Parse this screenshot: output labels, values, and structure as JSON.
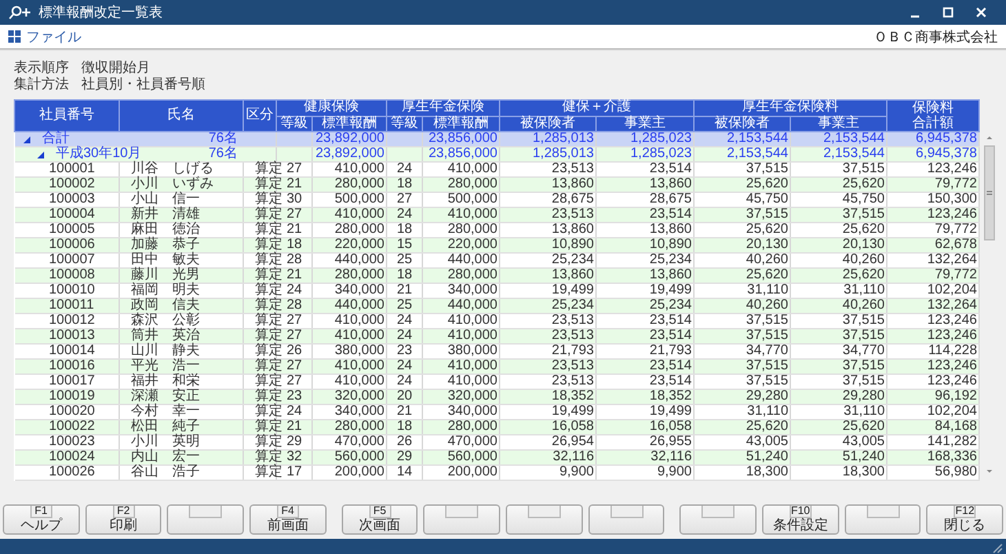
{
  "window": {
    "title": "標準報酬改定一覧表"
  },
  "menu": {
    "items": [
      {
        "label": "ファイル"
      }
    ],
    "company": "ＯＢＣ商事株式会社"
  },
  "conditions": [
    {
      "label": "表示順序",
      "value": "徴収開始月"
    },
    {
      "label": "集計方法",
      "value": "社員別・社員番号順"
    }
  ],
  "table": {
    "columns": [
      {
        "label": "社員番号"
      },
      {
        "label": "氏名"
      },
      {
        "label": "区分"
      },
      {
        "label": "健康保険",
        "children": [
          {
            "label": "等級"
          },
          {
            "label": "標準報酬"
          }
        ]
      },
      {
        "label": "厚生年金保険",
        "children": [
          {
            "label": "等級"
          },
          {
            "label": "標準報酬"
          }
        ]
      },
      {
        "label": "健保＋介護",
        "children": [
          {
            "label": "被保険者"
          },
          {
            "label": "事業主"
          }
        ]
      },
      {
        "label": "厚生年金保険料",
        "children": [
          {
            "label": "被保険者"
          },
          {
            "label": "事業主"
          }
        ]
      },
      {
        "label": "保険料合計額"
      }
    ],
    "rows": [
      {
        "kind": "total",
        "expanded": true,
        "label": "合計",
        "count": "76名",
        "amounts": [
          "23,892,000",
          "23,856,000",
          "1,285,013",
          "1,285,023",
          "2,153,544",
          "2,153,544",
          "6,945,378"
        ]
      },
      {
        "kind": "subtotal",
        "expanded": true,
        "label": "平成30年10月",
        "count": "76名",
        "amounts": [
          "23,892,000",
          "23,856,000",
          "1,285,013",
          "1,285,023",
          "2,153,544",
          "2,153,544",
          "6,945,378"
        ]
      },
      {
        "kind": "employee",
        "cells": [
          "100001",
          "川谷　しげる",
          "算定",
          "27",
          "410,000",
          "24",
          "410,000",
          "23,513",
          "23,514",
          "37,515",
          "37,515",
          "123,246"
        ]
      },
      {
        "kind": "employee",
        "cells": [
          "100002",
          "小川　いずみ",
          "算定",
          "21",
          "280,000",
          "18",
          "280,000",
          "13,860",
          "13,860",
          "25,620",
          "25,620",
          "79,772"
        ]
      },
      {
        "kind": "employee",
        "cells": [
          "100003",
          "小山　信一",
          "算定",
          "30",
          "500,000",
          "27",
          "500,000",
          "28,675",
          "28,675",
          "45,750",
          "45,750",
          "150,300"
        ]
      },
      {
        "kind": "employee",
        "cells": [
          "100004",
          "新井　清雄",
          "算定",
          "27",
          "410,000",
          "24",
          "410,000",
          "23,513",
          "23,514",
          "37,515",
          "37,515",
          "123,246"
        ]
      },
      {
        "kind": "employee",
        "cells": [
          "100005",
          "麻田　徳治",
          "算定",
          "21",
          "280,000",
          "18",
          "280,000",
          "13,860",
          "13,860",
          "25,620",
          "25,620",
          "79,772"
        ]
      },
      {
        "kind": "employee",
        "cells": [
          "100006",
          "加藤　恭子",
          "算定",
          "18",
          "220,000",
          "15",
          "220,000",
          "10,890",
          "10,890",
          "20,130",
          "20,130",
          "62,678"
        ]
      },
      {
        "kind": "employee",
        "cells": [
          "100007",
          "田中　敏夫",
          "算定",
          "28",
          "440,000",
          "25",
          "440,000",
          "25,234",
          "25,234",
          "40,260",
          "40,260",
          "132,264"
        ]
      },
      {
        "kind": "employee",
        "cells": [
          "100008",
          "藤川　光男",
          "算定",
          "21",
          "280,000",
          "18",
          "280,000",
          "13,860",
          "13,860",
          "25,620",
          "25,620",
          "79,772"
        ]
      },
      {
        "kind": "employee",
        "cells": [
          "100010",
          "福岡　明夫",
          "算定",
          "24",
          "340,000",
          "21",
          "340,000",
          "19,499",
          "19,499",
          "31,110",
          "31,110",
          "102,204"
        ]
      },
      {
        "kind": "employee",
        "cells": [
          "100011",
          "政岡　信夫",
          "算定",
          "28",
          "440,000",
          "25",
          "440,000",
          "25,234",
          "25,234",
          "40,260",
          "40,260",
          "132,264"
        ]
      },
      {
        "kind": "employee",
        "cells": [
          "100012",
          "森沢　公彰",
          "算定",
          "27",
          "410,000",
          "24",
          "410,000",
          "23,513",
          "23,514",
          "37,515",
          "37,515",
          "123,246"
        ]
      },
      {
        "kind": "employee",
        "cells": [
          "100013",
          "筒井　英治",
          "算定",
          "27",
          "410,000",
          "24",
          "410,000",
          "23,513",
          "23,514",
          "37,515",
          "37,515",
          "123,246"
        ]
      },
      {
        "kind": "employee",
        "cells": [
          "100014",
          "山川　静夫",
          "算定",
          "26",
          "380,000",
          "23",
          "380,000",
          "21,793",
          "21,793",
          "34,770",
          "34,770",
          "114,228"
        ]
      },
      {
        "kind": "employee",
        "cells": [
          "100016",
          "平光　浩一",
          "算定",
          "27",
          "410,000",
          "24",
          "410,000",
          "23,513",
          "23,514",
          "37,515",
          "37,515",
          "123,246"
        ]
      },
      {
        "kind": "employee",
        "cells": [
          "100017",
          "福井　和栄",
          "算定",
          "27",
          "410,000",
          "24",
          "410,000",
          "23,513",
          "23,514",
          "37,515",
          "37,515",
          "123,246"
        ]
      },
      {
        "kind": "employee",
        "cells": [
          "100019",
          "深瀬　安正",
          "算定",
          "23",
          "320,000",
          "20",
          "320,000",
          "18,352",
          "18,352",
          "29,280",
          "29,280",
          "96,192"
        ]
      },
      {
        "kind": "employee",
        "cells": [
          "100020",
          "今村　幸一",
          "算定",
          "24",
          "340,000",
          "21",
          "340,000",
          "19,499",
          "19,499",
          "31,110",
          "31,110",
          "102,204"
        ]
      },
      {
        "kind": "employee",
        "cells": [
          "100022",
          "松田　純子",
          "算定",
          "21",
          "280,000",
          "18",
          "280,000",
          "16,058",
          "16,058",
          "25,620",
          "25,620",
          "84,168"
        ]
      },
      {
        "kind": "employee",
        "cells": [
          "100023",
          "小川　英明",
          "算定",
          "29",
          "470,000",
          "26",
          "470,000",
          "26,954",
          "26,955",
          "43,005",
          "43,005",
          "141,282"
        ]
      },
      {
        "kind": "employee",
        "cells": [
          "100024",
          "内山　宏一",
          "算定",
          "32",
          "560,000",
          "29",
          "560,000",
          "32,116",
          "32,116",
          "51,240",
          "51,240",
          "168,336"
        ]
      },
      {
        "kind": "employee",
        "cells": [
          "100026",
          "谷山　浩子",
          "算定",
          "17",
          "200,000",
          "14",
          "200,000",
          "9,900",
          "9,900",
          "18,300",
          "18,300",
          "56,980"
        ]
      }
    ]
  },
  "function_keys": [
    {
      "kind": "key",
      "key": "F1",
      "label": "ヘルプ"
    },
    {
      "kind": "key",
      "key": "F2",
      "label": "印刷"
    },
    {
      "kind": "blank"
    },
    {
      "kind": "key",
      "key": "F4",
      "label": "前画面"
    },
    {
      "kind": "key",
      "key": "F5",
      "label": "次画面"
    },
    {
      "kind": "blank"
    },
    {
      "kind": "blank"
    },
    {
      "kind": "blank"
    },
    {
      "kind": "blank"
    },
    {
      "kind": "key",
      "key": "F10",
      "label": "条件設定"
    },
    {
      "kind": "blank"
    },
    {
      "kind": "key",
      "key": "F12",
      "label": "閉じる"
    }
  ]
}
